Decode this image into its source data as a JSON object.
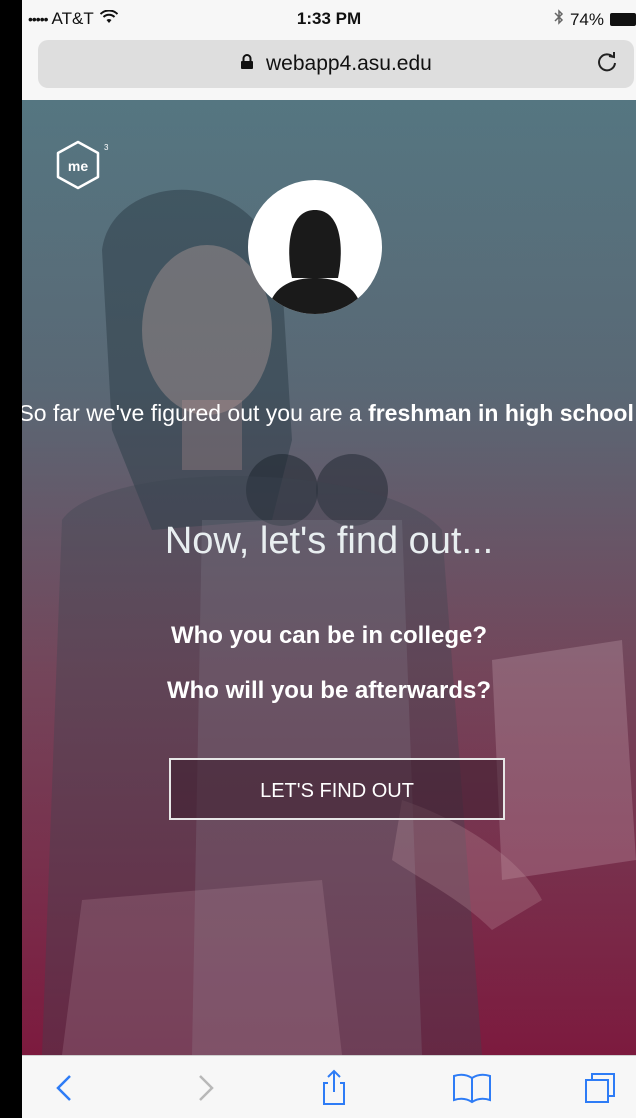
{
  "status_bar": {
    "signal": "•••••",
    "carrier": "AT&T",
    "time": "1:33 PM",
    "battery": "74%"
  },
  "browser": {
    "url": "webapp4.asu.edu"
  },
  "page": {
    "logo_text": "me",
    "logo_superscript": "3",
    "intro_prefix": "So far we've figured out you are a ",
    "intro_bold": "freshman in high school!",
    "headline": "Now, let's find out...",
    "question_1": "Who you can be in college?",
    "question_2": "Who will you be afterwards?",
    "cta_label": "LET'S FIND OUT"
  },
  "toolbar": {
    "icons": [
      "back-icon",
      "forward-icon",
      "share-icon",
      "bookmarks-icon",
      "tabs-icon"
    ]
  },
  "colors": {
    "gradient_top": "#466a76",
    "gradient_bottom": "#8a1d45"
  }
}
